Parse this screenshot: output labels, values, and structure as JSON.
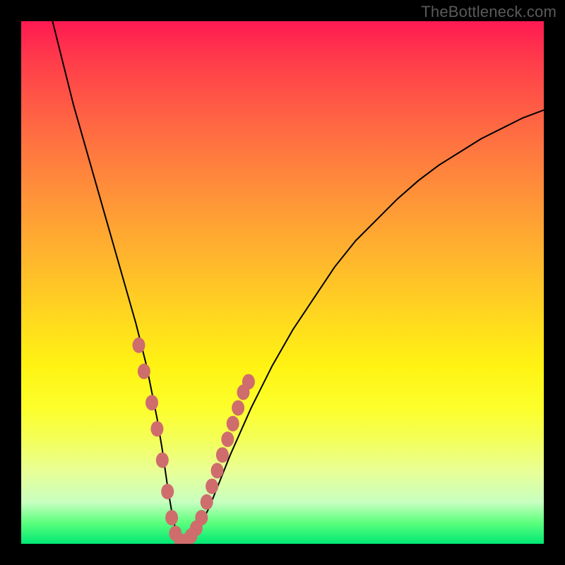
{
  "watermark": "TheBottleneck.com",
  "colors": {
    "frame": "#000000",
    "gradient_top": "#ff1a52",
    "gradient_bottom": "#00e874",
    "curve": "#000000",
    "marker_fill": "#cf6d6d",
    "marker_stroke": "#8d3a3a"
  },
  "chart_data": {
    "type": "line",
    "title": "",
    "xlabel": "",
    "ylabel": "",
    "xlim": [
      0,
      100
    ],
    "ylim": [
      0,
      100
    ],
    "grid": false,
    "legend": false,
    "series": [
      {
        "name": "bottleneck-curve",
        "x": [
          6,
          8,
          10,
          12,
          14,
          16,
          18,
          20,
          22,
          24,
          26,
          27,
          28,
          29,
          30,
          31,
          32,
          34,
          36,
          38,
          40,
          44,
          48,
          52,
          56,
          60,
          64,
          68,
          72,
          76,
          80,
          84,
          88,
          92,
          96,
          100
        ],
        "values": [
          100,
          92,
          84,
          77,
          70,
          63,
          56,
          49,
          42,
          34,
          24,
          18,
          11,
          5,
          1,
          0,
          0.5,
          3,
          7,
          12,
          17,
          26,
          34,
          41,
          47,
          53,
          58,
          62,
          66,
          69.5,
          72.5,
          75,
          77.5,
          79.5,
          81.5,
          83
        ]
      }
    ],
    "markers": [
      {
        "x": 22.5,
        "y": 38
      },
      {
        "x": 23.5,
        "y": 33
      },
      {
        "x": 25.0,
        "y": 27
      },
      {
        "x": 26.0,
        "y": 22
      },
      {
        "x": 27.0,
        "y": 16
      },
      {
        "x": 28.0,
        "y": 10
      },
      {
        "x": 28.8,
        "y": 5
      },
      {
        "x": 29.5,
        "y": 2
      },
      {
        "x": 30.5,
        "y": 0.5
      },
      {
        "x": 31.5,
        "y": 0.5
      },
      {
        "x": 32.5,
        "y": 1.5
      },
      {
        "x": 33.5,
        "y": 3
      },
      {
        "x": 34.5,
        "y": 5
      },
      {
        "x": 35.5,
        "y": 8
      },
      {
        "x": 36.5,
        "y": 11
      },
      {
        "x": 37.5,
        "y": 14
      },
      {
        "x": 38.5,
        "y": 17
      },
      {
        "x": 39.5,
        "y": 20
      },
      {
        "x": 40.5,
        "y": 23
      },
      {
        "x": 41.5,
        "y": 26
      },
      {
        "x": 42.5,
        "y": 29
      },
      {
        "x": 43.5,
        "y": 31
      }
    ]
  }
}
